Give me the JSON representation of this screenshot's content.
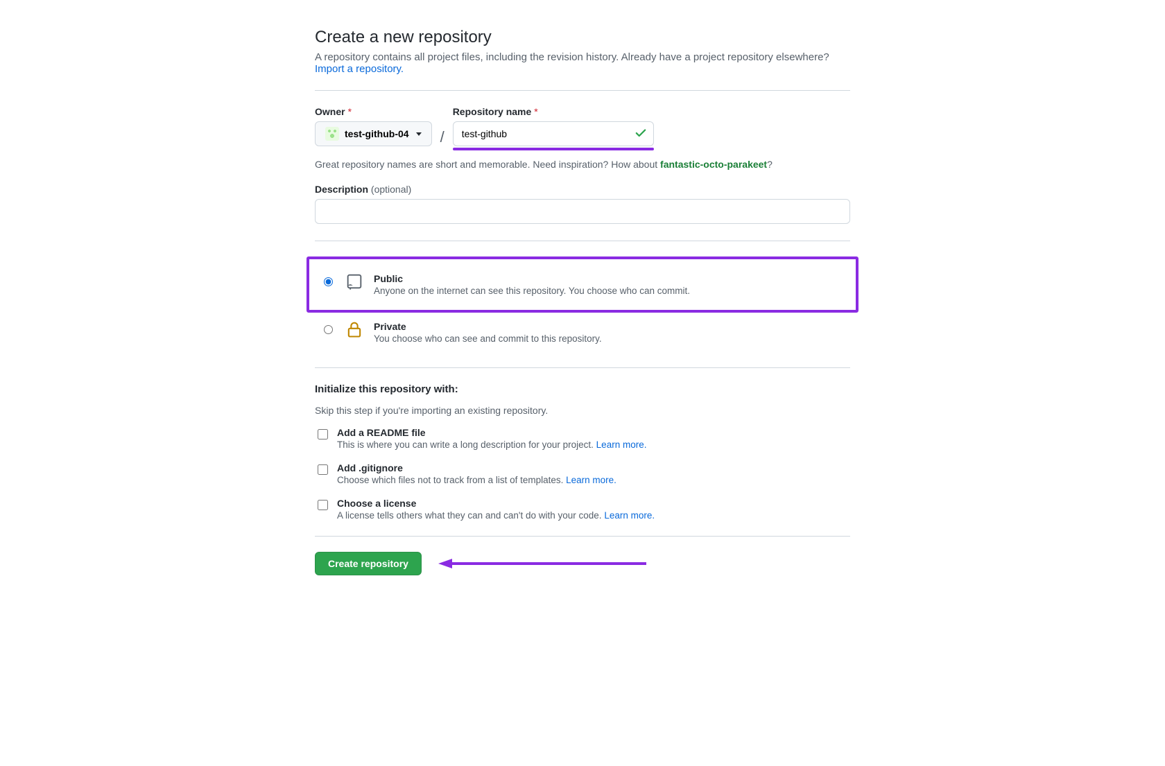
{
  "header": {
    "title": "Create a new repository",
    "lead_prefix": "A repository contains all project files, including the revision history. Already have a project repository elsewhere?",
    "import_link": "Import a repository."
  },
  "owner": {
    "label": "Owner",
    "value": "test-github-04"
  },
  "repo_name": {
    "label": "Repository name",
    "value": "test-github"
  },
  "name_help": {
    "prefix": "Great repository names are short and memorable. Need inspiration? How about ",
    "suggestion": "fantastic-octo-parakeet",
    "suffix": "?"
  },
  "description": {
    "label": "Description",
    "optional": "(optional)",
    "value": ""
  },
  "visibility": {
    "public": {
      "title": "Public",
      "desc": "Anyone on the internet can see this repository. You choose who can commit."
    },
    "private": {
      "title": "Private",
      "desc": "You choose who can see and commit to this repository."
    }
  },
  "initialize": {
    "heading": "Initialize this repository with:",
    "sub": "Skip this step if you're importing an existing repository.",
    "readme": {
      "title": "Add a README file",
      "desc_prefix": "This is where you can write a long description for your project. ",
      "learn_more": "Learn more."
    },
    "gitignore": {
      "title": "Add .gitignore",
      "desc_prefix": "Choose which files not to track from a list of templates. ",
      "learn_more": "Learn more."
    },
    "license": {
      "title": "Choose a license",
      "desc_prefix": "A license tells others what they can and can't do with your code. ",
      "learn_more": "Learn more."
    }
  },
  "submit": {
    "label": "Create repository"
  }
}
